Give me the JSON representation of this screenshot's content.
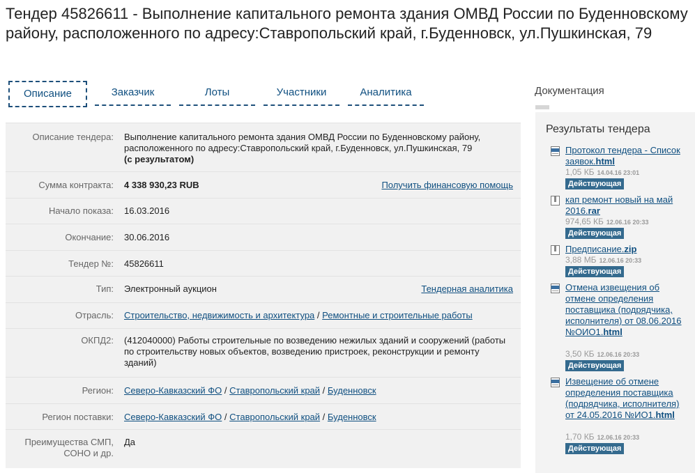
{
  "title": "Тендер 45826611 - Выполнение капитального ремонта здания ОМВД России по Буденновскому району, расположенного по адресу:Ставропольский край, г.Буденновск, ул.Пушкинская, 79",
  "tabs": [
    {
      "label": "Описание",
      "active": true
    },
    {
      "label": "Заказчик"
    },
    {
      "label": "Лоты"
    },
    {
      "label": "Участники"
    },
    {
      "label": "Аналитика"
    }
  ],
  "details": {
    "description": {
      "label": "Описание тендера:",
      "text": "Выполнение капитального ремонта здания ОМВД России по Буденновскому району, расположенного по адресу:Ставропольский край, г.Буденновск, ул.Пушкинская, 79",
      "status": "(с результатом)"
    },
    "amount": {
      "label": "Сумма контракта:",
      "value": "4 338 930,23 RUB",
      "link": "Получить финансовую помощь"
    },
    "start": {
      "label": "Начало показа:",
      "value": "16.03.2016"
    },
    "end": {
      "label": "Окончание:",
      "value": "30.06.2016"
    },
    "number": {
      "label": "Тендер №:",
      "value": "45826611"
    },
    "type": {
      "label": "Тип:",
      "value": "Электронный аукцион",
      "link": "Тендерная аналитика"
    },
    "industry": {
      "label": "Отрасль:",
      "link1": "Строительство, недвижимость и архитектура",
      "sep": "/",
      "link2": "Ремонтные и строительные работы"
    },
    "okpd": {
      "label": "ОКПД2:",
      "value": "(412040000) Работы строительные по возведению нежилых зданий и сооружений (работы по строительству новых объектов, возведению пристроек, реконструкции и ремонту зданий)"
    },
    "region": {
      "label": "Регион:",
      "l1": "Северо-Кавказский ФО",
      "l2": "Ставропольский край",
      "l3": "Буденновск",
      "sep": "/"
    },
    "delivery_region": {
      "label": "Регион поставки:",
      "l1": "Северо-Кавказский ФО",
      "l2": "Ставропольский край",
      "l3": "Буденновск",
      "sep": "/"
    },
    "smp": {
      "label": "Преимущества СМП, СОНО и др.",
      "value": "Да"
    }
  },
  "docs": {
    "header": "Документация",
    "results_title": "Результаты тендера",
    "files": [
      {
        "icon": "html-file-icon",
        "name": "Протокол тендера - Список заявок.",
        "ext": "html",
        "size": "1,05 КБ",
        "date": "14.04.16 23:01",
        "status": "Действующая"
      },
      {
        "icon": "archive-file-icon",
        "name": "кап ремонт новый на май 2016.",
        "ext": "rar",
        "size": "974,65 КБ",
        "date": "12.06.16 20:33",
        "status": "Действующая"
      },
      {
        "icon": "archive-file-icon",
        "name": "Предписание.",
        "ext": "zip",
        "size": "3,88 МБ",
        "date": "12.06.16 20:33",
        "status": "Действующая"
      },
      {
        "icon": "html-file-icon",
        "name": "Отмена извещения об отмене определения поставщика (подрядчика, исполнителя) от 08.06.2016 №ОИО1.",
        "ext": "html",
        "size": "3,50 КБ",
        "date": "12.06.16 20:33",
        "status": "Действующая"
      },
      {
        "icon": "html-file-icon",
        "name": "Извещение об отмене определения поставщика (подрядчика, исполнителя) от 24.05.2016 №ИО1.",
        "ext": "html",
        "size": "1,70 КБ",
        "date": "12.06.16 20:33",
        "status": "Действующая"
      }
    ]
  }
}
